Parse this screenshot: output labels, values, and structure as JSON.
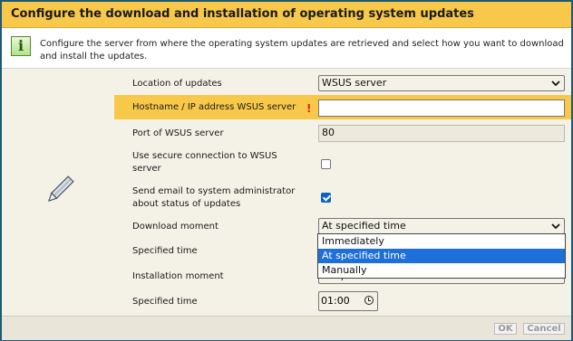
{
  "dialog": {
    "title": "Configure the download and installation of operating system updates",
    "info_text": "Configure the server from where the operating system updates are retrieved and select how you want to download and install the updates."
  },
  "fields": {
    "location": {
      "label": "Location of updates",
      "value": "WSUS server"
    },
    "hostname": {
      "label": "Hostname / IP address WSUS server",
      "required_mark": "!",
      "value": ""
    },
    "port": {
      "label": "Port of WSUS server",
      "value": "80"
    },
    "secure": {
      "label": "Use secure connection to WSUS server",
      "checked": false
    },
    "email": {
      "label": "Send email to system administrator about status of updates",
      "checked": true
    },
    "download_moment": {
      "label": "Download moment",
      "value": "At specified time"
    },
    "download_time": {
      "label": "Specified time"
    },
    "install_moment": {
      "label": "Installation moment",
      "value": "At specified time"
    },
    "install_time": {
      "label": "Specified time",
      "value": "01:00"
    }
  },
  "dropdown_options": [
    "Immediately",
    "At specified time",
    "Manually"
  ],
  "dropdown_selected": "At specified time",
  "footer": {
    "ok_label": "OK",
    "cancel_label": "Cancel"
  },
  "colors": {
    "title_bar": "#f7c84a",
    "highlight_row": "#f7c84a",
    "selection": "#1e6fd9",
    "border": "#1f5a73"
  },
  "icons": [
    "info-icon",
    "pencil-icon",
    "chevron-down-icon",
    "clock-icon"
  ]
}
